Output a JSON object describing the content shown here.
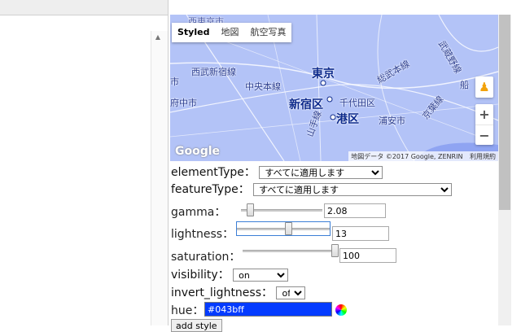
{
  "map": {
    "type_buttons": [
      "Styled",
      "地図",
      "航空写真"
    ],
    "labels": {
      "tokyo": "東京",
      "shinjuku": "新宿区",
      "minato": "港区",
      "chiyoda": "千代田区",
      "urayasu": "浦安市",
      "chuo_line": "中央本線",
      "seibu": "西武新宿線",
      "fuchu": "府中市",
      "yamanote": "山手線",
      "sobu": "総武本線",
      "keiyo": "京葉線",
      "musashino": "武蔵野線",
      "nishitokyo": "西東京市",
      "funa": "船",
      "ichi": "市",
      "kai": "線"
    },
    "attribution": "地図データ ©2017 Google, ZENRIN",
    "terms": "利用規約",
    "google_logo": "Google",
    "zoom_in": "+",
    "zoom_out": "−"
  },
  "controls": {
    "element_type": {
      "label": "elementType：",
      "value": "すべてに適用します"
    },
    "feature_type": {
      "label": "featureType：",
      "value": "すべてに適用します"
    },
    "gamma": {
      "label": "gamma：",
      "value": "2.08",
      "level": 0.08
    },
    "lightness": {
      "label": "lightness：",
      "value": "13",
      "level": 0.56
    },
    "saturation": {
      "label": "saturation：",
      "value": "100",
      "level": 1.0
    },
    "visibility": {
      "label": "visibility：",
      "value": "on"
    },
    "invert_lightness": {
      "label": "invert_lightness：",
      "value": "off"
    },
    "hue": {
      "label": "hue：",
      "value": "#043bff"
    },
    "add_style_button": "add style"
  },
  "colors": {
    "map_water": "#a7b9f5",
    "hue": "#043bff"
  }
}
